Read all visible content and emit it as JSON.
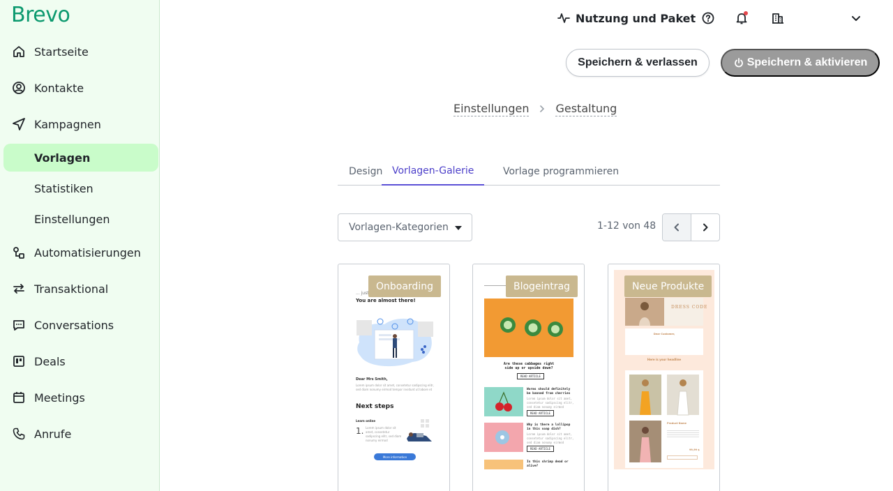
{
  "brand": {
    "logo_text": "Brevo",
    "accent": "#0b996e"
  },
  "sidebar": {
    "items": [
      {
        "label": "Startseite",
        "icon": "home-icon"
      },
      {
        "label": "Kontakte",
        "icon": "contact-icon"
      },
      {
        "label": "Kampagnen",
        "icon": "send-icon"
      },
      {
        "label": "Vorlagen",
        "active": true
      },
      {
        "label": "Statistiken"
      },
      {
        "label": "Einstellungen"
      },
      {
        "label": "Automatisierungen",
        "icon": "automation-icon"
      },
      {
        "label": "Transaktional",
        "icon": "transfer-icon"
      },
      {
        "label": "Conversations",
        "icon": "chat-icon"
      },
      {
        "label": "Deals",
        "icon": "board-icon"
      },
      {
        "label": "Meetings",
        "icon": "calendar-icon"
      },
      {
        "label": "Anrufe",
        "icon": "phone-icon"
      }
    ]
  },
  "topbar": {
    "usage_label": "Nutzung und Paket",
    "icons": [
      "activity-icon",
      "help-icon",
      "bell-icon",
      "building-icon",
      "chevron-down-icon"
    ]
  },
  "actions": {
    "save_leave": "Speichern & verlassen",
    "save_activate": "Speichern & aktivieren"
  },
  "breadcrumb": {
    "step1": "Einstellungen",
    "step2": "Gestaltung"
  },
  "tabs": [
    {
      "label": "Design"
    },
    {
      "label": "Vorlagen-Galerie",
      "active": true
    },
    {
      "label": "Vorlage programmieren"
    }
  ],
  "filter": {
    "category_placeholder": "Vorlagen-Kategorien"
  },
  "pagination": {
    "range_text": "1-12 von 48"
  },
  "cards": [
    {
      "badge": "Onboarding",
      "preview": {
        "header": "... just",
        "title": "You are almost there!",
        "greeting": "Dear Mrs Smith,",
        "body": "Lorem ipsum dolor sit amet, consetetur sadipscing elitr, sed diam nonumy eirmod tempor invidunt ut labore et dolore",
        "section": "Next steps",
        "step_title": "Learn online",
        "step_number": "1.",
        "step_text": "Lorem ipsum dolor sit amet, consetetur sadipscing elitr, sed diam nonumy eirmod",
        "button": "More information"
      }
    },
    {
      "badge": "Blogeintrag",
      "preview": {
        "headline": "Are these cabbages right side up or upside down?",
        "read": "READ ARTICLE",
        "item1": "Worms should definitely be banned from cherries",
        "item2": "Why is there a lollipop in this soap dish?",
        "item3": "Is this shrimp dead or alive?",
        "lorem": "Lorem ipsum dolor sit amet, consetetur sadipscing elitr, sed diam nonumy eirmod tempor."
      }
    },
    {
      "badge": "Neue Produkte",
      "preview": {
        "dress_code": "DRESS CODE",
        "customer": "Dear Customer,",
        "headline": "Here is your headline",
        "product": "Product Name",
        "price": "99,99 $"
      }
    }
  ]
}
